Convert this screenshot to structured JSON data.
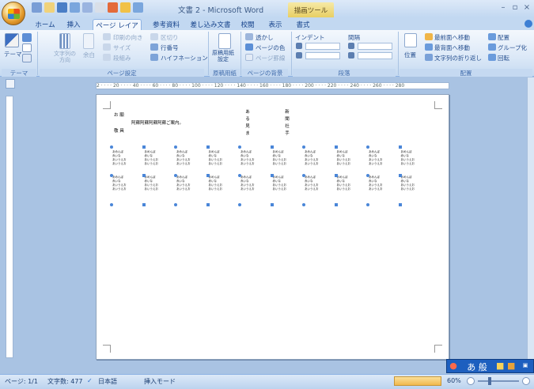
{
  "window": {
    "title": "文書 2 - Microsoft Word",
    "contextual_group": "描画ツール",
    "controls": [
      "–",
      "▫",
      "×"
    ]
  },
  "tabs": [
    "ホーム",
    "挿入",
    "ページ レイアウト",
    "参考資料",
    "差し込み文書",
    "校閲",
    "表示",
    "書式"
  ],
  "active_tab": "ページ レイアウト",
  "ribbon": {
    "theme_group": {
      "label": "テーマ",
      "theme_btn": "テーマ"
    },
    "page_setup": {
      "label": "ページ設定",
      "text_direction": "文字列の\n方向",
      "margins": "余白",
      "orientation": "印刷の向き",
      "breaks": "区切り",
      "size": "サイズ",
      "line_numbers": "行番号",
      "columns": "段組み",
      "hyphenation": "ハイフネーション"
    },
    "paper": {
      "label": "原稿用紙",
      "btn": "原稿用紙\n設定"
    },
    "background": {
      "label": "ページの背景",
      "watermark": "透かし",
      "page_color": "ページの色",
      "page_border": "ページ罫線"
    },
    "paragraph": {
      "label": "段落",
      "indent": "インデント",
      "spacing": "間隔"
    },
    "arrange": {
      "label": "配置",
      "position": "位置",
      "bring_front": "最前面へ移動",
      "send_back": "最背面へ移動",
      "wrap": "文字列の折り返し",
      "align": "配置",
      "group": "グループ化",
      "rotate": "回転"
    }
  },
  "ruler_text": "2 · · · · 20 · · · · 40 · · · · 60 · · · · 80 · · · · 100 · · · · 120 · · · · 140 · · · · 160 · · · · 180 · · · · 200 · · · · 220 · · · · 240 · · · · 260 · · · · 280",
  "document": {
    "left_lines": [
      "お 願",
      "阿蘇阿蘇阿蘇阿蘇ご案内。",
      "敬 具"
    ],
    "center_vertical_1": [
      "ある",
      "見",
      "ま",
      "す",
      "ら"
    ],
    "center_vertical_2": [
      "新 聞",
      "社",
      "寄",
      "手"
    ],
    "cell_text": [
      "あめんぼ",
      "赤いな",
      "あいうえお",
      "あいうえお"
    ]
  },
  "status": {
    "page": "ページ: 1/1",
    "words": "文字数: 477",
    "language": "日本語",
    "mode": "挿入モード",
    "zoom": "60%"
  },
  "ime": {
    "text": "あ 般"
  }
}
